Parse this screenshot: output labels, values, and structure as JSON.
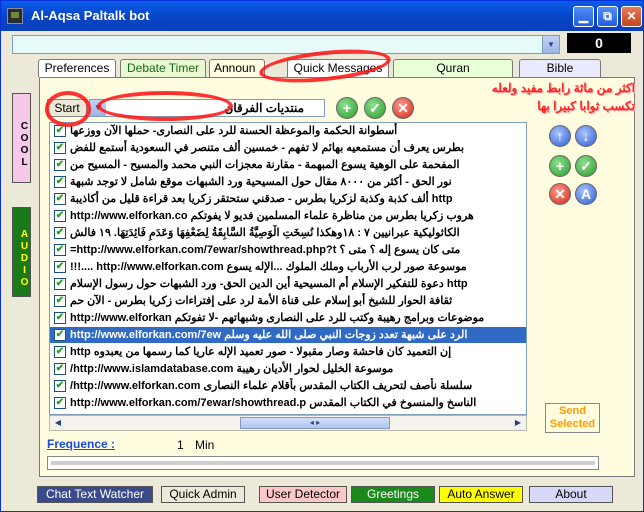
{
  "window": {
    "title": "Al-Aqsa Paltalk bot"
  },
  "top": {
    "counter": "0"
  },
  "tabs": [
    {
      "label": "Preferences"
    },
    {
      "label": "Debate Timer"
    },
    {
      "label": "Announ"
    },
    {
      "label": "Quick Messages"
    },
    {
      "label": "Quran"
    },
    {
      "label": "Bible"
    }
  ],
  "side": {
    "cool": "COOL",
    "audio": "AUDIO"
  },
  "controls": {
    "start": "Start",
    "forum_value": "منتديات الفرقان"
  },
  "annotation": {
    "line1": "اكثر من مائة رابط مفيد ولعله",
    "line2": "تكسب ثوابا كبيرا بها"
  },
  "messages": [
    {
      "text": "أسطوانة الحكمة والموعظة الحسنة للرد على النصارى- حملها الآن ووزعها"
    },
    {
      "text": "بطرس يعرف أن مستمعيه بهائم لا تفهم - خمسين ألف متنصر في السعودية أستمع للفض"
    },
    {
      "text": "المفحمة على الوهية يسوع المبهمة - مقارنة معجزات النبي محمد والمسيح - المسيح من"
    },
    {
      "text": "نور الحق - أكثر من ٨٠٠٠ مقال حول المسيحية ورد الشبهات موقع شامل لا توجد شبهة"
    },
    {
      "text": "http ألف كذبة وكذبة لزكريا بطرس - صدقني ستحتقر زكريا بعد قراءة قليل من أكاذيبة"
    },
    {
      "text": "هروب زكريا بطرس من مناظرة علماء المسلمين فديو لا يفوتكم http://www.elforkan.co"
    },
    {
      "text": "الكاثوليكية عبرانيين ٧ : ١٨وهكذا نُسِخَتِ الْوَصِيَّةُ السَّابِقَةُ لِضَعْفِهَا وَعَدَمِ فَائِدَتِهَا. ١٩ فالش"
    },
    {
      "text": "متى كان يسوع إله ؟ متى ؟ http://www.elforkan.com/7ewar/showthread.php?t="
    },
    {
      "text": "موسوعة صور لرب الأرباب وملك الملوك ...الإله يسوع http://www.elforkan.com ....!!!"
    },
    {
      "text": "http دعوة للتفكير الإسلام أم المسيحية أين الدين الحق- ورد الشبهات حول رسول الإسلام"
    },
    {
      "text": "ثقافة الحوار للشيخ أبو إسلام على قناة الأمة لرد على إفتراءات زكريا بطرس - الآن حم"
    },
    {
      "text": "موضوعات وبرامج رهيبة وكتب للرد على النصارى وشبهاتهم -لا تفوتكم http://www.elforkan"
    },
    {
      "text": "الرد على شبهة تعدد زوجات النبي صلى الله عليه وسلم http://www.elforkan.com/7ew"
    },
    {
      "text": "إن التعميد كان فاحشة وصار مقبولا - صور تعميد الإله عاريا كما رسمها من يعبدوه http"
    },
    {
      "text": "موسوعة الخليل لحوار الأديان رهيبة http://www.islamdatabase.com/"
    },
    {
      "text": "سلسلة نأصف لتحريف الكتاب المقدس بأقلام علماء النصارى http://www.elforkan.com/"
    },
    {
      "text": "الناسخ والمنسوخ في الكتاب المقدس http://www.elforkan.com/7ewar/showthread.p"
    }
  ],
  "selected_row": 12,
  "send_selected": "Send Selected",
  "frequence": {
    "label": "Frequence :",
    "value": "1",
    "unit": "Min"
  },
  "bottom_buttons": [
    {
      "label": "Chat Text Watcher",
      "bg": "#3a4b8a",
      "fg": "#ffffff"
    },
    {
      "label": "Quick Admin",
      "bg": "#ece9d8",
      "fg": "#000000"
    },
    {
      "label": "User Detector",
      "bg": "#ffc8c8",
      "fg": "#000000"
    },
    {
      "label": "Greetings",
      "bg": "#1a8a1a",
      "fg": "#ffffff"
    },
    {
      "label": "Auto Answer",
      "bg": "#ffff00",
      "fg": "#000000"
    },
    {
      "label": "About",
      "bg": "#d8d8f8",
      "fg": "#000000"
    }
  ],
  "colors": {
    "accent": "#0846c9",
    "selection": "#316ac5",
    "annotation": "#ff2222"
  }
}
